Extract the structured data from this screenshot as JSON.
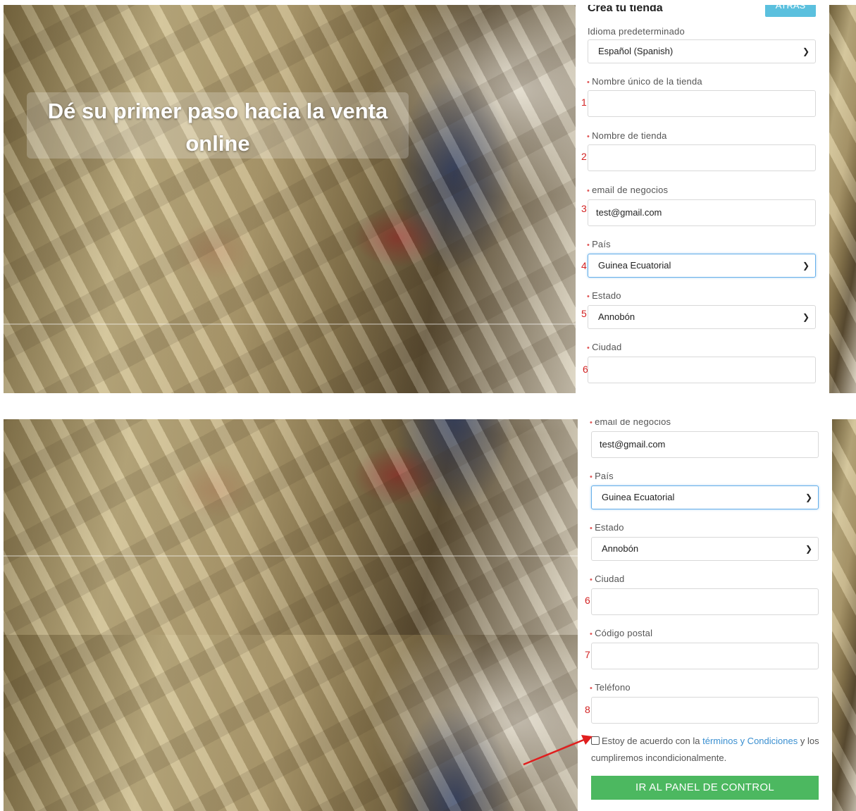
{
  "hero": {
    "headline": "Dé su primer paso hacia la venta online"
  },
  "top_form": {
    "title": "Crea tu tienda",
    "back_button": "ATRÁS",
    "language_label": "Idioma predeterminado",
    "language_value": "Español (Spanish)",
    "store_id_label": "Nombre único de la tienda",
    "store_id_value": "",
    "store_name_label": "Nombre de tienda",
    "store_name_value": "",
    "email_label": "email de negocios",
    "email_value": "test@gmail.com",
    "country_label": "País",
    "country_value": "Guinea Ecuatorial",
    "state_label": "Estado",
    "state_value": "Annobón",
    "city_label": "Ciudad",
    "city_value": ""
  },
  "bottom_form": {
    "email_label": "email de negocios",
    "email_value": "test@gmail.com",
    "country_label": "País",
    "country_value": "Guinea Ecuatorial",
    "state_label": "Estado",
    "state_value": "Annobón",
    "city_label": "Ciudad",
    "city_value": "",
    "postal_label": "Código postal",
    "postal_value": "",
    "phone_label": "Teléfono",
    "phone_value": "",
    "terms_prefix": "Estoy de acuerdo con la",
    "terms_link": "términos y Condiciones",
    "terms_suffix": "y los cumpliremos incondicionalmente.",
    "terms_checked": false,
    "submit_button": "IR AL PANEL DE CONTROL"
  },
  "step_numbers": [
    "1",
    "2",
    "3",
    "4",
    "5",
    "6",
    "7",
    "8"
  ],
  "required_mark": "•",
  "icons": {
    "dropdown": "chevron-down-icon",
    "annotation": "red-arrow-icon"
  },
  "colors": {
    "back_button": "#5bc0de",
    "submit_button": "#4cb860",
    "step_number": "#d32222",
    "required_mark": "#e05a5a",
    "link": "#3a8fd0",
    "focus_border": "#66afe9"
  }
}
